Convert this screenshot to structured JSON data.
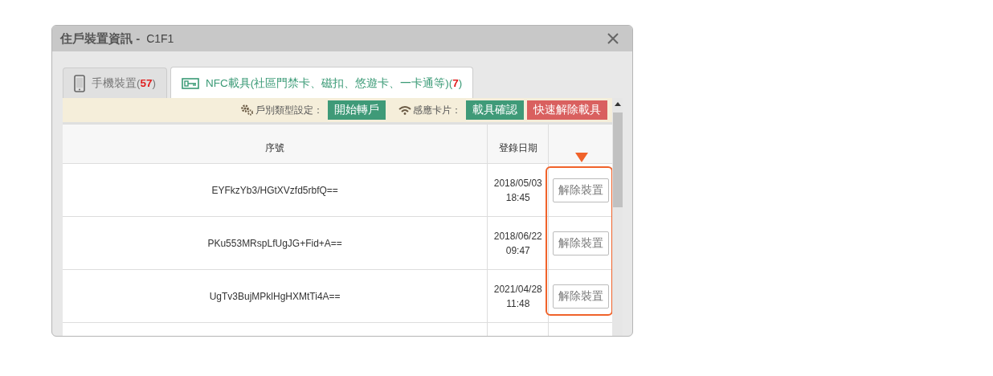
{
  "window": {
    "title": "住戶裝置資訊 -",
    "subtitle": "C1F1"
  },
  "tabs": [
    {
      "kind": "phone",
      "label": "手機裝置(**57**)",
      "selected": false
    },
    {
      "kind": "nfc",
      "label": "NFC載具(社區門禁卡、磁扣、悠遊卡、一卡通等)(**7**)",
      "selected": true
    }
  ],
  "toolbar": [
    {
      "kind": "gear",
      "label": "戶別類型設定：",
      "buttons": [
        {
          "label": "開始轉戶",
          "kind": "green"
        }
      ]
    },
    {
      "kind": "wifi",
      "label": "感應卡片：",
      "buttons": [
        {
          "label": "載具確認",
          "kind": "green"
        },
        {
          "label": "快速解除載具",
          "kind": "red"
        }
      ]
    }
  ],
  "table": {
    "columns": [
      "序號",
      "登錄日期"
    ],
    "rows": [
      {
        "serial": "EYFkzYb3/HGtXVzfd5rbfQ==",
        "date": "2018/05/03",
        "time": "18:45",
        "action": "解除裝置"
      },
      {
        "serial": "PKu553MRspLfUgJG+Fid+A==",
        "date": "2018/06/22",
        "time": "09:47",
        "action": "解除裝置"
      },
      {
        "serial": "UgTv3BujMPklHgHXMtTi4A==",
        "date": "2021/04/28",
        "time": "11:48",
        "action": "解除裝置"
      }
    ]
  }
}
